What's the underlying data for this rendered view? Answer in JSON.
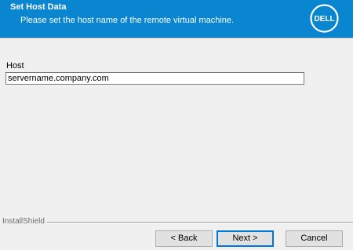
{
  "header": {
    "title": "Set Host Data",
    "subtitle": "Please set the host name of the remote virtual machine.",
    "logo_icon": "dell-logo-icon",
    "background_color": "#0a85d0"
  },
  "form": {
    "host_label": "Host",
    "host_value": "servername.company.com"
  },
  "footer": {
    "brand": "InstallShield"
  },
  "buttons": {
    "back_label": "< Back",
    "next_label": "Next >",
    "cancel_label": "Cancel"
  }
}
